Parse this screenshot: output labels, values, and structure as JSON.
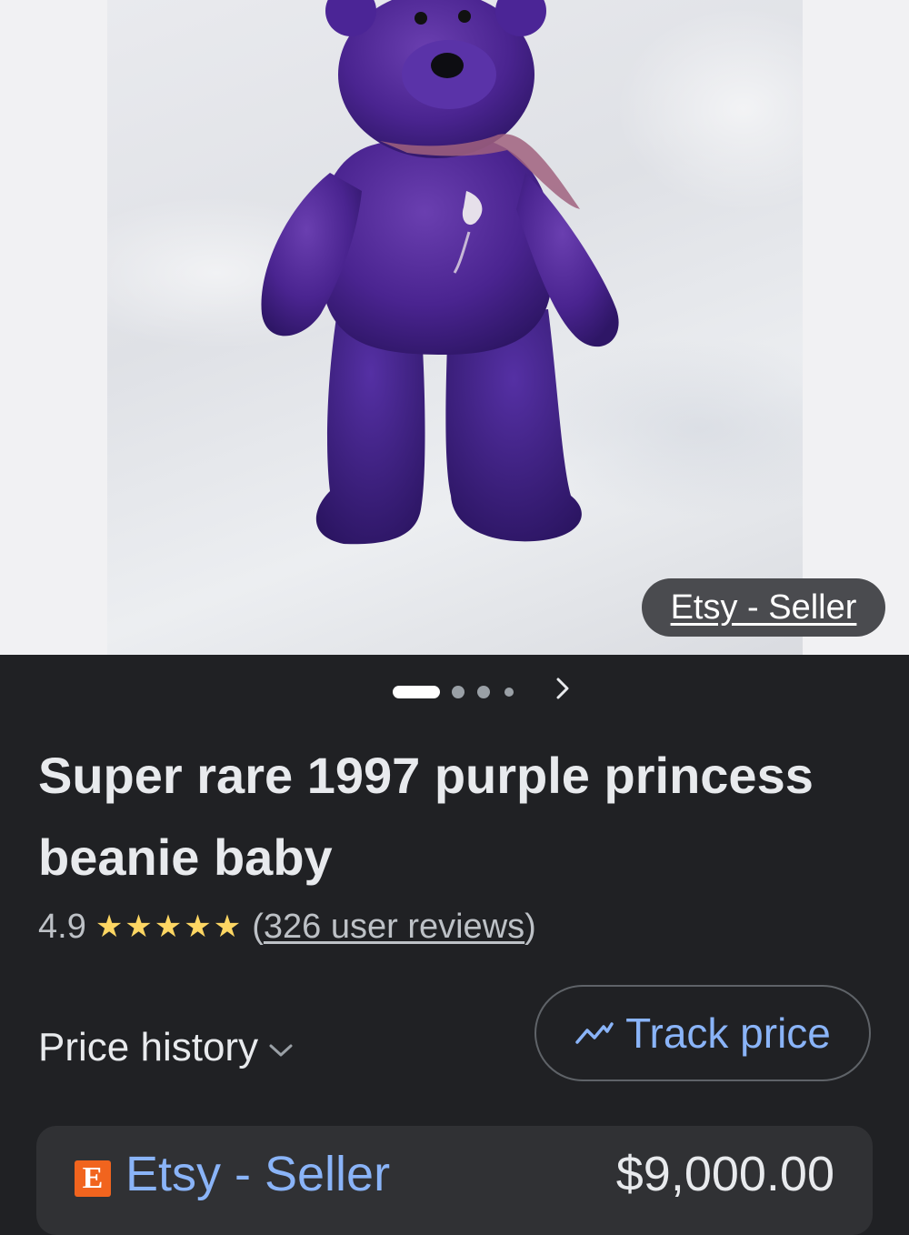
{
  "image": {
    "source_label": "Etsy - Seller"
  },
  "carousel": {
    "total_slides": 4,
    "active_index": 0,
    "next_icon": "chevron-right-icon"
  },
  "product": {
    "title": "Super rare 1997 purple princess beanie baby",
    "rating": "4.9",
    "stars": "★★★★★",
    "rating_stars_value": 5,
    "reviews_open": "(",
    "reviews_text": "326 user reviews",
    "reviews_close": ")"
  },
  "price_history": {
    "label": "Price history",
    "icon": "chevron-down-icon"
  },
  "track_price": {
    "label": "Track price",
    "icon": "trend-line-icon"
  },
  "offer": {
    "seller_logo_letter": "E",
    "seller": "Etsy - Seller",
    "price": "$9,000.00"
  },
  "colors": {
    "background": "#202124",
    "link_blue": "#8ab4f8",
    "star_yellow": "#fdd663",
    "etsy_orange": "#f1641e",
    "card": "#303134"
  }
}
